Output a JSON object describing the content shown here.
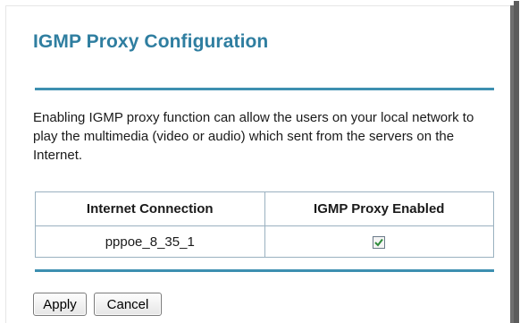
{
  "page": {
    "title": "IGMP Proxy Configuration",
    "description": "Enabling IGMP proxy function can allow the users on your local network to play the multimedia (video or audio) which sent from the servers on the Internet."
  },
  "table": {
    "columns": [
      "Internet Connection",
      "IGMP Proxy Enabled"
    ],
    "rows": [
      {
        "connection": "pppoe_8_35_1",
        "proxy_enabled": true
      }
    ]
  },
  "buttons": {
    "apply": "Apply",
    "cancel": "Cancel"
  },
  "colors": {
    "title": "#2f7ea0",
    "divider": "#3d8fb0",
    "check": "#2e8b3a"
  }
}
